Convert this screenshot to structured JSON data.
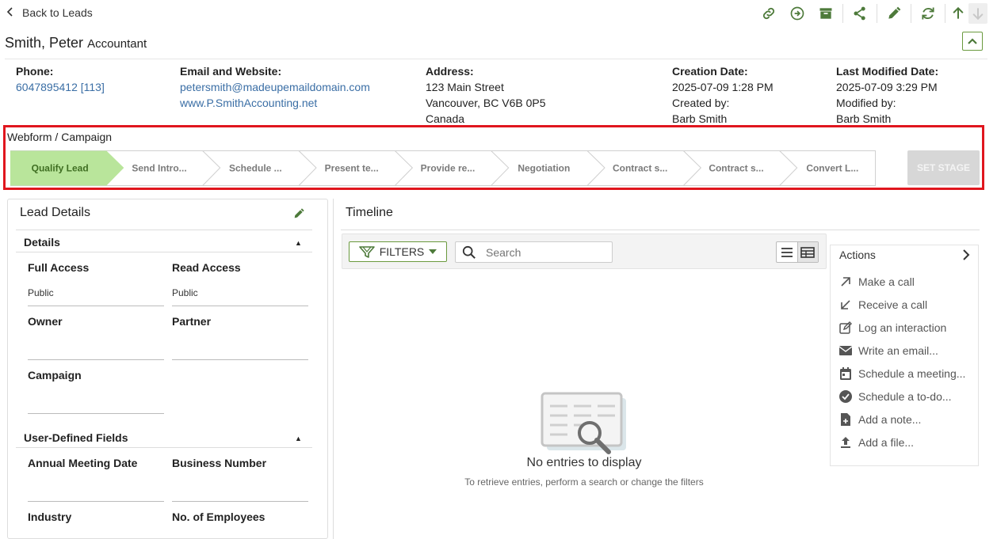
{
  "nav": {
    "back_label": "Back to Leads"
  },
  "toolbar": {
    "icons": [
      "link-icon",
      "arrow-right-circle-icon",
      "archive-icon",
      "share-icon",
      "pencil-icon",
      "refresh-icon",
      "arrow-up-icon",
      "arrow-down-icon"
    ]
  },
  "lead": {
    "name": "Smith, Peter",
    "title": "Accountant"
  },
  "info": {
    "phone_label": "Phone:",
    "phone": "6047895412 [113]",
    "email_label": "Email and Website:",
    "email": "petersmith@madeupemaildomain.com",
    "website": "www.P.SmithAccounting.net",
    "address_label": "Address:",
    "address_line1": "123 Main Street",
    "address_line2": "Vancouver, BC V6B 0P5",
    "address_line3": "Canada",
    "created_label": "Creation Date:",
    "created_date": "2025-07-09 1:28 PM",
    "created_by_label": "Created by:",
    "created_by": "Barb Smith",
    "modified_label": "Last Modified Date:",
    "modified_date": "2025-07-09 3:29 PM",
    "modified_by_label": "Modified by:",
    "modified_by": "Barb Smith"
  },
  "pipeline": {
    "category": "Webform / Campaign",
    "stages": [
      "Qualify Lead",
      "Send Intro...",
      "Schedule ...",
      "Present te...",
      "Provide re...",
      "Negotiation",
      "Contract s...",
      "Contract s...",
      "Convert L..."
    ],
    "active_index": 0,
    "set_stage_label": "SET STAGE"
  },
  "lead_details": {
    "title": "Lead Details",
    "details_section": "Details",
    "full_access_label": "Full Access",
    "full_access_value": "Public",
    "read_access_label": "Read Access",
    "read_access_value": "Public",
    "owner_label": "Owner",
    "partner_label": "Partner",
    "campaign_label": "Campaign",
    "udf_section": "User-Defined Fields",
    "annual_meeting_label": "Annual Meeting Date",
    "business_number_label": "Business Number",
    "industry_label": "Industry",
    "employees_label": "No. of Employees"
  },
  "timeline": {
    "title": "Timeline",
    "filters_label": "FILTERS",
    "search_placeholder": "Search",
    "empty_title": "No entries to display",
    "empty_sub": "To retrieve entries, perform a search or change the filters"
  },
  "actions": {
    "title": "Actions",
    "items": [
      {
        "label": "Make a call",
        "icon": "arrow-up-right-icon"
      },
      {
        "label": "Receive a call",
        "icon": "arrow-down-left-icon"
      },
      {
        "label": "Log an interaction",
        "icon": "edit-note-icon"
      },
      {
        "label": "Write an email...",
        "icon": "envelope-icon"
      },
      {
        "label": "Schedule a meeting...",
        "icon": "calendar-icon"
      },
      {
        "label": "Schedule a to-do...",
        "icon": "check-circle-icon"
      },
      {
        "label": "Add a note...",
        "icon": "note-add-icon"
      },
      {
        "label": "Add a file...",
        "icon": "upload-icon"
      }
    ]
  },
  "colors": {
    "accent": "#4d7a3a",
    "active_stage": "#b9e59b",
    "highlight_border": "#e0161e",
    "link": "#3a6ea5"
  }
}
